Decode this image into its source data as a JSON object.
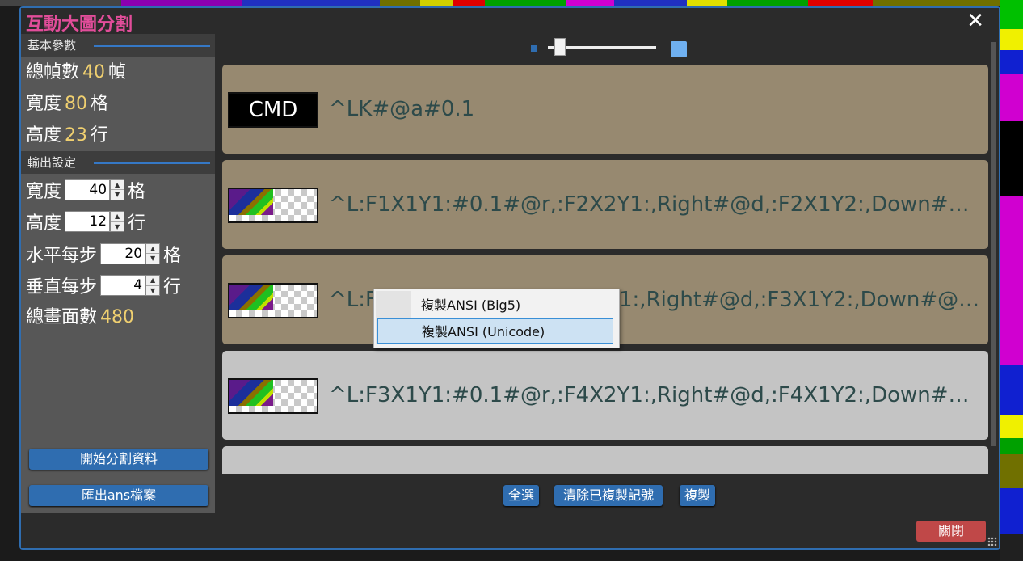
{
  "window": {
    "title": "互動大圖分割",
    "close_glyph": "✕"
  },
  "sidebar": {
    "basic_section": "基本參數",
    "info": [
      {
        "label": "總幀數",
        "value": "40",
        "unit": "幀"
      },
      {
        "label": "寬度",
        "value": "80",
        "unit": "格"
      },
      {
        "label": "高度",
        "value": "23",
        "unit": "行"
      }
    ],
    "output_section": "輸出設定",
    "settings": [
      {
        "label": "寬度",
        "value": "40",
        "unit": "格"
      },
      {
        "label": "高度",
        "value": "12",
        "unit": "行"
      },
      {
        "label": "水平每步",
        "value": "20",
        "unit": "格"
      },
      {
        "label": "垂直每步",
        "value": "4",
        "unit": "行"
      }
    ],
    "total_label": "總畫面數",
    "total_value": "480",
    "start_button": "開始分割資料",
    "export_button": "匯出ans檔案"
  },
  "zoom_slider": {
    "value_fraction": 0.1
  },
  "cards": [
    {
      "thumb_text": "CMD",
      "code": "^LK#@a#0.1",
      "state": "selected"
    },
    {
      "code": "^L:F1X1Y1:#0.1#@r,:F2X2Y1:,Right#@d,:F2X1Y2:,Down#@E...",
      "state": "selected"
    },
    {
      "code_left": "^L:F",
      "code_right": "1:,Right#@d,:F3X1Y2:,Down#@E...",
      "state": "selected"
    },
    {
      "code": "^L:F3X1Y1:#0.1#@r,:F4X2Y1:,Right#@d,:F4X1Y2:,Down#@E...",
      "state": "normal"
    }
  ],
  "context_menu": {
    "items": [
      "複製ANSI (Big5)",
      "複製ANSI (Unicode)"
    ],
    "highlighted": "複製ANSI (Unicode)"
  },
  "bottom_buttons": {
    "select_all": "全選",
    "clear_marks": "清除已複製記號",
    "copy": "複製"
  },
  "footer": {
    "close_button": "關閉"
  },
  "colors": {
    "accent": "#2f6db0",
    "title": "#e24d9a",
    "value": "#f0d070",
    "selected_card": "#978970",
    "normal_card": "#c4c4c4",
    "close": "#c04848"
  }
}
